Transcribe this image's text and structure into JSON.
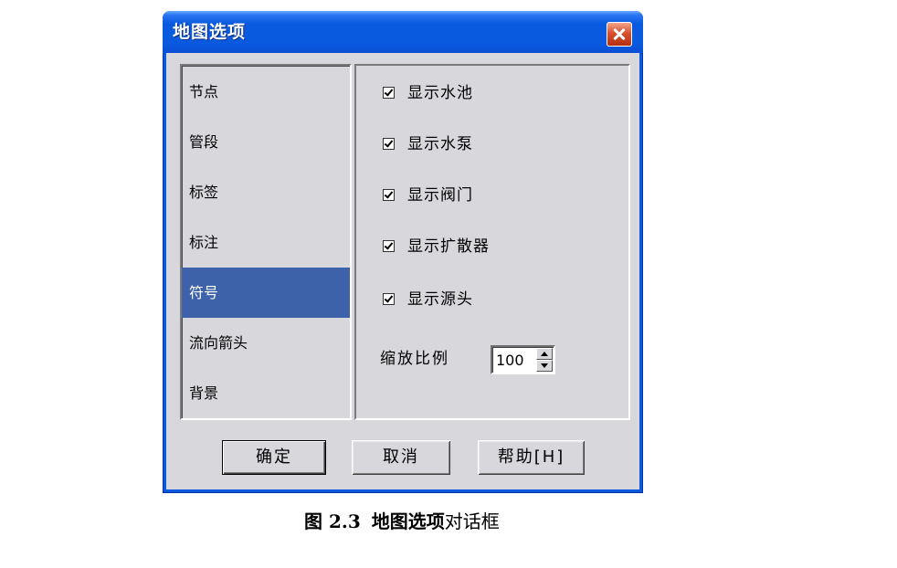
{
  "dialog": {
    "title": "地图选项",
    "close_icon": "close-icon"
  },
  "categories": {
    "items": [
      {
        "label": "节点",
        "selected": false
      },
      {
        "label": "管段",
        "selected": false
      },
      {
        "label": "标签",
        "selected": false
      },
      {
        "label": "标注",
        "selected": false
      },
      {
        "label": "符号",
        "selected": true
      },
      {
        "label": "流向箭头",
        "selected": false
      },
      {
        "label": "背景",
        "selected": false
      }
    ]
  },
  "symbols_page": {
    "options": [
      {
        "label": "显示水池",
        "checked": true
      },
      {
        "label": "显示水泵",
        "checked": true
      },
      {
        "label": "显示阀门",
        "checked": true
      },
      {
        "label": "显示扩散器",
        "checked": true
      },
      {
        "label": "显示源头",
        "checked": true
      }
    ],
    "scale": {
      "label": "缩放比例",
      "value": "100",
      "up_icon": "up-arrow-icon",
      "down_icon": "down-arrow-icon"
    }
  },
  "buttons": {
    "ok": "确定",
    "cancel": "取消",
    "help": "帮助[H]"
  },
  "caption": {
    "figure_number": "图 2.3",
    "title": "地图选项",
    "suffix": "对话框"
  },
  "colors": {
    "title_bar": "#0a5ae0",
    "selection": "#3d62aa",
    "close_button": "#d8502e",
    "dialog_background": "#d8d7db"
  }
}
